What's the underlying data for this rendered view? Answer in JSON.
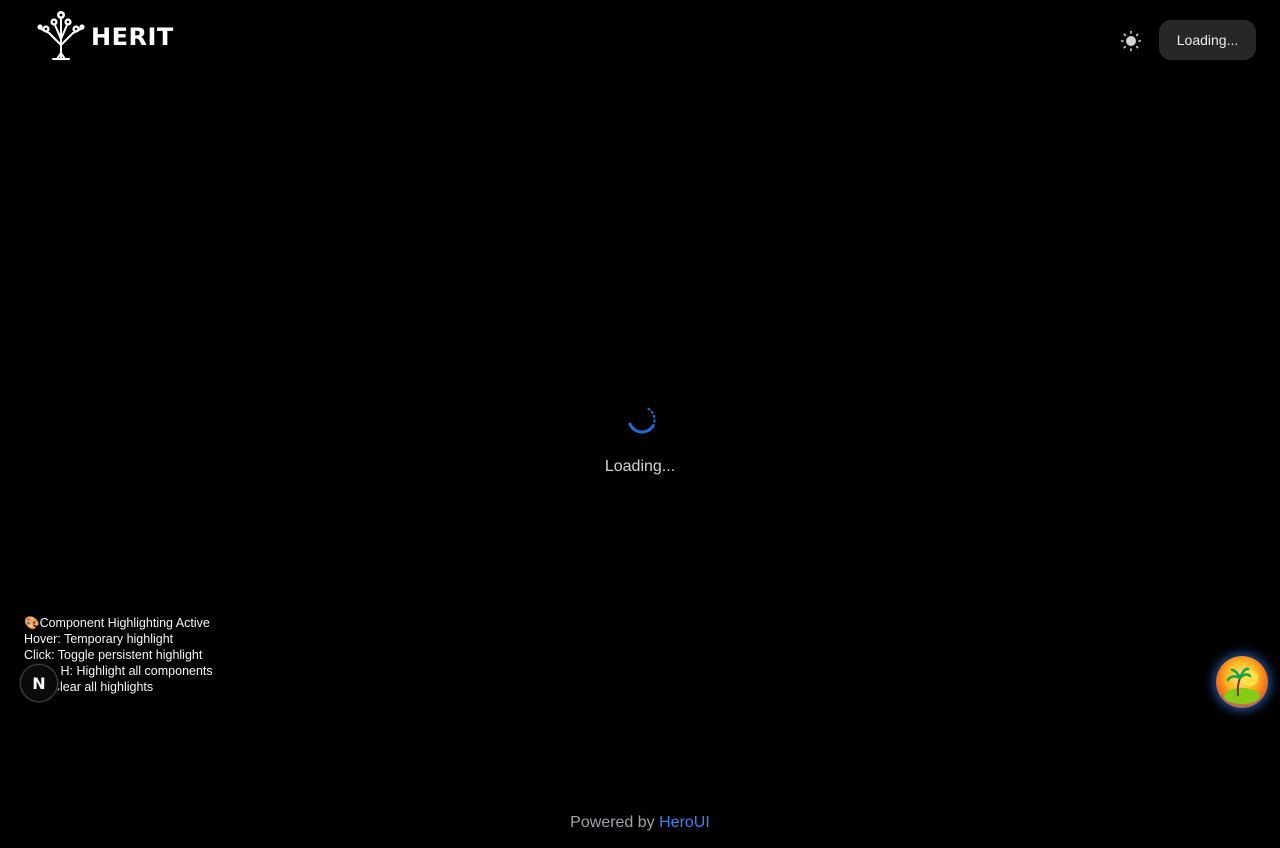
{
  "header": {
    "brand": "HERIT",
    "theme_icon": "sun-icon",
    "auth_button_label": "Loading..."
  },
  "main": {
    "loading_text": "Loading...",
    "spinner_color": "#1d6ddc"
  },
  "debug_panel": {
    "line1_icon": "palette-icon",
    "line1": "Component Highlighting Active",
    "line2": "Hover: Temporary highlight",
    "line3": "Click: Toggle persistent highlight",
    "line4": "H: Highlight all components",
    "line5": "Clear all highlights"
  },
  "dev_badge": {
    "letter": "N"
  },
  "floating_button": {
    "icon": "island-sunset-icon"
  },
  "footer": {
    "prefix": "Powered by",
    "link_text": "HeroUI",
    "link_color": "#3b82f6"
  }
}
